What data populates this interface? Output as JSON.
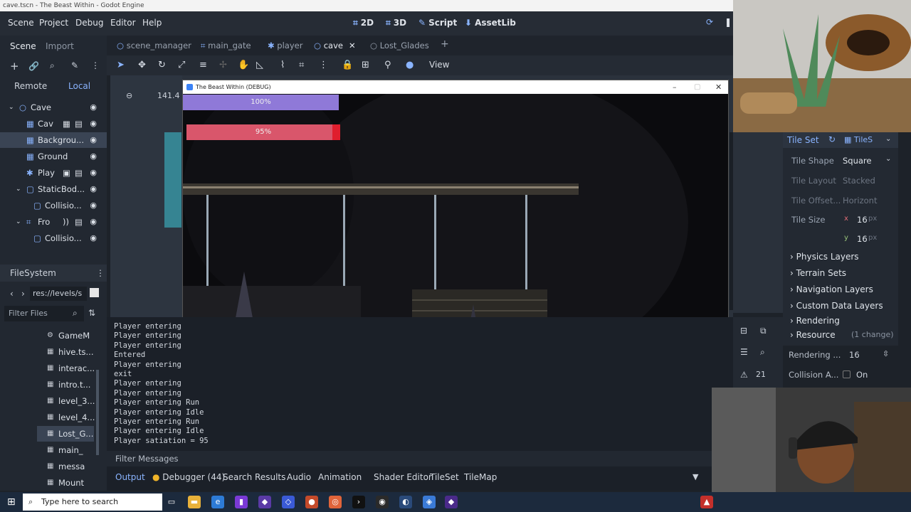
{
  "window_title": "cave.tscn - The Beast Within - Godot Engine",
  "menu": {
    "items": [
      "Scene",
      "Project",
      "Debug",
      "Editor",
      "Help"
    ],
    "workspaces": [
      "2D",
      "3D",
      "Script",
      "AssetLib"
    ]
  },
  "left_dock": {
    "tabs": [
      "Scene",
      "Import"
    ],
    "remote": "Remote",
    "local": "Local",
    "tree": [
      "Cave",
      "Cav",
      "Backgrou...",
      "Ground",
      "Play",
      "StaticBod...",
      "Collisio...",
      "Fro",
      "Collisio..."
    ],
    "filesystem_tab": "FileSystem",
    "path": "res://levels/s",
    "filter_placeholder": "Filter Files",
    "files": [
      "GameM",
      "hive.ts...",
      "interac...",
      "intro.t...",
      "level_3...",
      "level_4...",
      "Lost_G...",
      "main_",
      "messa",
      "Mount"
    ]
  },
  "scene_tabs": [
    "scene_manager",
    "main_gate",
    "player",
    "cave",
    "Lost_Glades"
  ],
  "toolbar": {
    "view_label": "View",
    "zoom": "141.4"
  },
  "game_window": {
    "title": "The Beast Within (DEBUG)",
    "health_label": "100%",
    "health_value": 1.0,
    "satiation_label": "95%",
    "satiation_value": 0.95
  },
  "output": {
    "lines": [
      "Player entering",
      "Player entering",
      "Player entering",
      "Entered",
      "Player entering",
      "exit",
      "Player entering",
      "Player entering",
      "Player entering Run",
      "Player entering Idle",
      "Player entering Run",
      "Player entering Idle",
      "Player satiation = 95"
    ],
    "filter_placeholder": "Filter Messages",
    "bottom_tabs": [
      "Output",
      "Debugger (44)",
      "Search Results",
      "Audio",
      "Animation",
      "Shader Editor",
      "TileSet",
      "TileMap"
    ]
  },
  "inspector": {
    "tab": "Tile Set",
    "tab2": "TileS",
    "tile_shape_label": "Tile Shape",
    "tile_shape_value": "Square",
    "tile_layout_label": "Tile Layout",
    "tile_layout_value": "Stacked",
    "tile_offset_label": "Tile Offset...",
    "tile_offset_value": "Horizont",
    "tile_size_label": "Tile Size",
    "tile_size_x": "16",
    "tile_size_y": "16",
    "px": "px",
    "sections": [
      "Physics Layers",
      "Terrain Sets",
      "Navigation Layers",
      "Custom Data Layers",
      "Rendering",
      "Resource"
    ],
    "resource_note": "(1 change)",
    "rendering_label": "Rendering ...",
    "rendering_value": "16",
    "collision_label": "Collision A...",
    "collision_value": "On",
    "count": "21"
  },
  "taskbar": {
    "search_placeholder": "Type here to search"
  },
  "colors": {
    "accent": "#8ab4ff",
    "health": "#8f79d8",
    "satiation": "#d9566b",
    "satiation_end": "#e01e2e",
    "water": "#2aa4b0"
  }
}
